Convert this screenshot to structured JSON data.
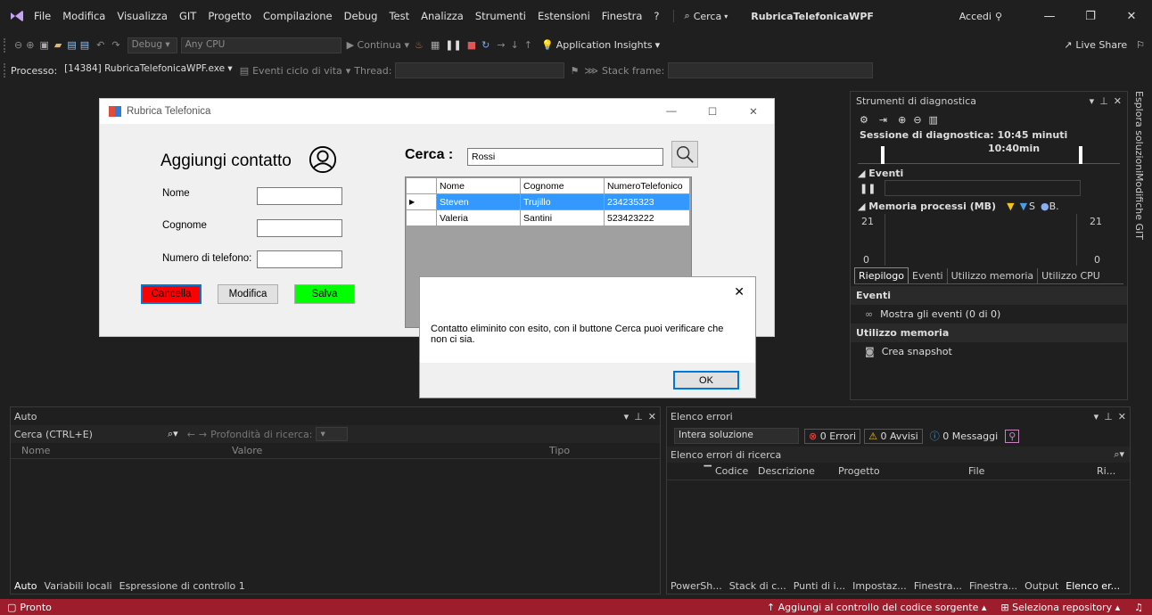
{
  "titlebar": {
    "menu": [
      "File",
      "Modifica",
      "Visualizza",
      "GIT",
      "Progetto",
      "Compilazione",
      "Debug",
      "Test",
      "Analizza",
      "Strumenti",
      "Estensioni",
      "Finestra",
      "?"
    ],
    "search": "Cerca",
    "project": "RubricaTelefonicaWPF",
    "signin": "Accedi"
  },
  "toolbar1": {
    "config": "Debug",
    "platform": "Any CPU",
    "continue": "Continua",
    "insights": "Application Insights",
    "liveshare": "Live Share"
  },
  "toolbar2": {
    "process_label": "Processo:",
    "process_value": "[14384] RubricaTelefonicaWPF.exe",
    "lifecycle": "Eventi ciclo di vita",
    "thread": "Thread:",
    "stackframe": "Stack frame:"
  },
  "app": {
    "title": "Rubrica Telefonica",
    "heading": "Aggiungi contatto",
    "labels": {
      "nome": "Nome",
      "cognome": "Cognome",
      "numero": "Numero di telefono:"
    },
    "buttons": {
      "cancella": "Cancella",
      "modifica": "Modifica",
      "salva": "Salva"
    },
    "search_label": "Cerca :",
    "search_value": "Rossi",
    "grid": {
      "headers": [
        "Nome",
        "Cognome",
        "NumeroTelefonico"
      ],
      "rows": [
        [
          "Steven",
          "Trujillo",
          "234235323"
        ],
        [
          "Valeria",
          "Santini",
          "523423222"
        ]
      ]
    }
  },
  "msgbox": {
    "text": "Contatto eliminito con esito, con il buttone Cerca puoi verificare che non ci sia.",
    "ok": "OK"
  },
  "diag": {
    "title": "Strumenti di diagnostica",
    "session": "Sessione di diagnostica: 10:45 minuti",
    "time": "10:40min",
    "events": "Eventi",
    "memory": "Memoria processi (MB)",
    "mem_legend_s": "S",
    "mem_legend_b": "B.",
    "mem_top": "21",
    "mem_bottom": "0",
    "tabs": [
      "Riepilogo",
      "Eventi",
      "Utilizzo memoria",
      "Utilizzo CPU"
    ],
    "section_events": "Eventi",
    "show_events": "Mostra gli eventi (0 di 0)",
    "section_memory": "Utilizzo memoria",
    "snapshot": "Crea snapshot",
    "side_tabs": [
      "Esplora soluzioni",
      "Modifiche GIT"
    ]
  },
  "auto": {
    "title": "Auto",
    "search": "Cerca (CTRL+E)",
    "depth": "Profondità di ricerca:",
    "columns": [
      "Nome",
      "Valore",
      "Tipo"
    ],
    "tabs": [
      "Auto",
      "Variabili locali",
      "Espressione di controllo 1"
    ]
  },
  "errors": {
    "title": "Elenco errori",
    "scope": "Intera soluzione",
    "errors": "0 Errori",
    "warnings": "0 Avvisi",
    "messages": "0 Messaggi",
    "search": "Elenco errori di ricerca",
    "columns": [
      "Codice",
      "Descrizione",
      "Progetto",
      "File",
      "Ri..."
    ],
    "tabs": [
      "PowerSh...",
      "Stack di c...",
      "Punti di i...",
      "Impostaz...",
      "Finestra...",
      "Finestra...",
      "Output",
      "Elenco er..."
    ]
  },
  "status": {
    "ready": "Pronto",
    "source_control": "Aggiungi al controllo del codice sorgente",
    "repo": "Seleziona repository"
  }
}
